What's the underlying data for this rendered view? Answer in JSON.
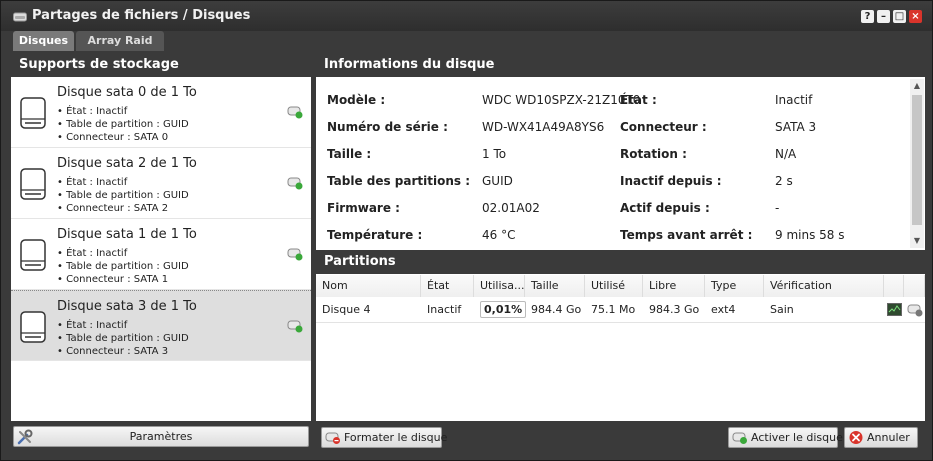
{
  "window": {
    "title": "Partages de fichiers / Disques",
    "controls": [
      "?",
      "–",
      "□",
      "×"
    ]
  },
  "tabs": [
    {
      "label": "Disques",
      "active": true
    },
    {
      "label": "Array Raid",
      "active": false
    }
  ],
  "storage": {
    "header": "Supports de stockage",
    "disks": [
      {
        "title": "Disque sata 0 de 1 To",
        "state": "• État : Inactif",
        "partition": "• Table de partition : GUID",
        "connector": "• Connecteur : SATA 0"
      },
      {
        "title": "Disque sata 2 de 1 To",
        "state": "• État : Inactif",
        "partition": "• Table de partition : GUID",
        "connector": "• Connecteur : SATA 2"
      },
      {
        "title": "Disque sata 1 de 1 To",
        "state": "• État : Inactif",
        "partition": "• Table de partition : GUID",
        "connector": "• Connecteur : SATA 1"
      },
      {
        "title": "Disque sata 3 de 1 To",
        "state": "• État : Inactif",
        "partition": "• Table de partition : GUID",
        "connector": "• Connecteur : SATA 3"
      }
    ],
    "params_label": "Paramètres"
  },
  "info": {
    "header": "Informations du disque",
    "left": [
      {
        "label": "Modèle :",
        "value": "WDC WD10SPZX-21Z10T0"
      },
      {
        "label": "Numéro de série :",
        "value": "WD-WX41A49A8YS6"
      },
      {
        "label": "Taille :",
        "value": "1 To"
      },
      {
        "label": "Table des partitions :",
        "value": "GUID"
      },
      {
        "label": "Firmware :",
        "value": "02.01A02"
      },
      {
        "label": "Température :",
        "value": "46 °C"
      }
    ],
    "right": [
      {
        "label": "État :",
        "value": "Inactif"
      },
      {
        "label": "Connecteur :",
        "value": "SATA 3"
      },
      {
        "label": "Rotation :",
        "value": "N/A"
      },
      {
        "label": "Inactif depuis :",
        "value": "2 s"
      },
      {
        "label": "Actif depuis :",
        "value": "-"
      },
      {
        "label": "Temps avant arrêt :",
        "value": "9 mins 58 s"
      }
    ]
  },
  "partitions": {
    "header": "Partitions",
    "columns": [
      "Nom",
      "État",
      "Utilisa...",
      "Taille",
      "Utilisé",
      "Libre",
      "Type",
      "Vérification"
    ],
    "rows": [
      {
        "name": "Disque 4",
        "state": "Inactif",
        "usage": "0,01%",
        "size": "984.4 Go",
        "used": "75.1 Mo",
        "free": "984.3 Go",
        "type": "ext4",
        "check": "Sain"
      }
    ]
  },
  "footer": {
    "format_label": "Formater le disque",
    "activate_label": "Activer le disque",
    "cancel_label": "Annuler"
  },
  "colors": {
    "titlebar": "#2e2e2e",
    "panel_header": "#3a3a3a",
    "selected_row": "#dedede",
    "close_button": "#d9342b"
  }
}
